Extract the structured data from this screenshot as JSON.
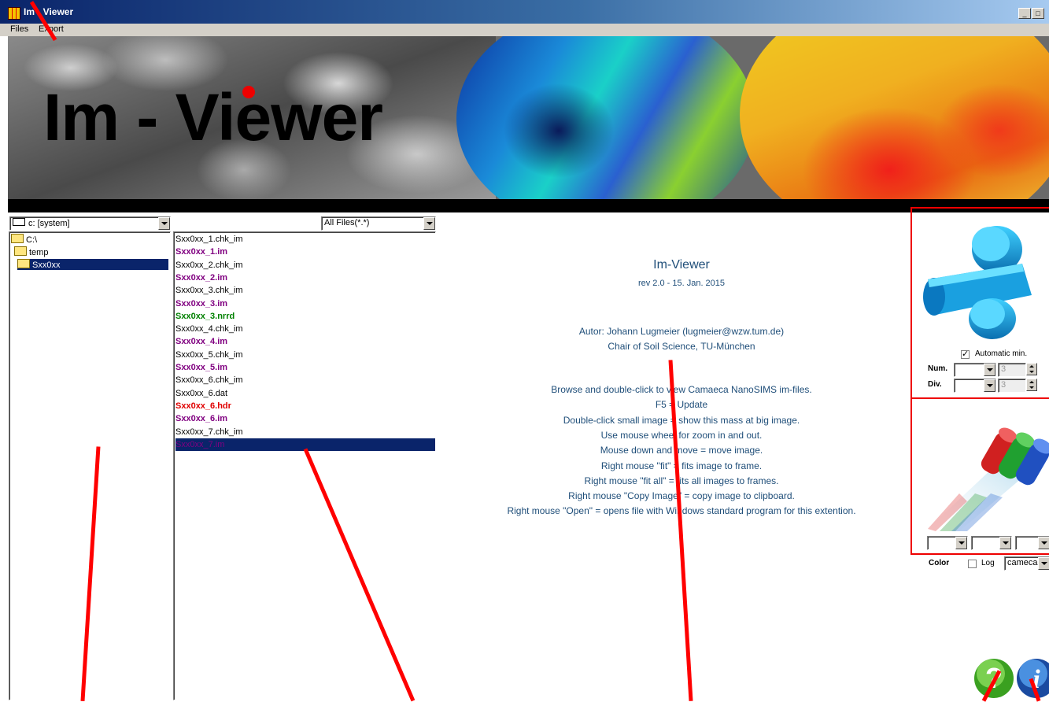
{
  "window": {
    "title": "Im - Viewer",
    "minimize_label": "_",
    "maximize_label": "□"
  },
  "menu": {
    "files": "Files",
    "export": "Export"
  },
  "banner": {
    "title": "Im - Viewer"
  },
  "drive": {
    "value": "c: [system]"
  },
  "filter": {
    "value": "All Files(*.*)"
  },
  "tree": [
    {
      "label": "C:\\",
      "selected": false
    },
    {
      "label": "temp",
      "selected": false
    },
    {
      "label": "Sxx0xx",
      "selected": true
    }
  ],
  "files": [
    {
      "name": "Sxx0xx_1.chk_im",
      "color": "#000000",
      "bold": false
    },
    {
      "name": "Sxx0xx_1.im",
      "color": "#800080",
      "bold": true
    },
    {
      "name": "Sxx0xx_2.chk_im",
      "color": "#000000",
      "bold": false
    },
    {
      "name": "Sxx0xx_2.im",
      "color": "#800080",
      "bold": true
    },
    {
      "name": "Sxx0xx_3.chk_im",
      "color": "#000000",
      "bold": false
    },
    {
      "name": "Sxx0xx_3.im",
      "color": "#800080",
      "bold": true
    },
    {
      "name": "Sxx0xx_3.nrrd",
      "color": "#008000",
      "bold": true
    },
    {
      "name": "Sxx0xx_4.chk_im",
      "color": "#000000",
      "bold": false
    },
    {
      "name": "Sxx0xx_4.im",
      "color": "#800080",
      "bold": true
    },
    {
      "name": "Sxx0xx_5.chk_im",
      "color": "#000000",
      "bold": false
    },
    {
      "name": "Sxx0xx_5.im",
      "color": "#800080",
      "bold": true
    },
    {
      "name": "Sxx0xx_6.chk_im",
      "color": "#000000",
      "bold": false
    },
    {
      "name": "Sxx0xx_6.dat",
      "color": "#000000",
      "bold": false
    },
    {
      "name": "Sxx0xx_6.hdr",
      "color": "#e00000",
      "bold": true
    },
    {
      "name": "Sxx0xx_6.im",
      "color": "#800080",
      "bold": true
    },
    {
      "name": "Sxx0xx_7.chk_im",
      "color": "#000000",
      "bold": false
    },
    {
      "name": "Sxx0xx_7.im",
      "color": "#800080",
      "bold": false,
      "selected": true
    }
  ],
  "about": {
    "name": "Im-Viewer",
    "revision": "rev 2.0 - 15. Jan. 2015",
    "author": "Autor: Johann Lugmeier (lugmeier@wzw.tum.de)",
    "affiliation": "Chair of Soil Science, TU-München",
    "help": [
      "Browse and double-click to view Camaeca NanoSIMS im-files.",
      "F5 = Update",
      "Double-click small image = show this mass at big image.",
      "Use mouse wheel for zoom in and out.",
      "Mouse down and move = move image.",
      "Right mouse \"fit\" = fits image to frame.",
      "Right mouse \"fit all\" = fits all images to frames.",
      "Right mouse \"Copy Image\" = copy image to clipboard.",
      "Right mouse \"Open\" = opens file with Windows standard program for this extention."
    ]
  },
  "ratio": {
    "automatic_min_label": "Automatic min.",
    "automatic_min_checked": true,
    "num_label": "Num.",
    "div_label": "Div.",
    "num_value": "",
    "div_value": "",
    "num_spin": "3",
    "div_spin": "3"
  },
  "color": {
    "label": "Color",
    "log_label": "Log",
    "log_checked": false,
    "palette": "cameca"
  }
}
